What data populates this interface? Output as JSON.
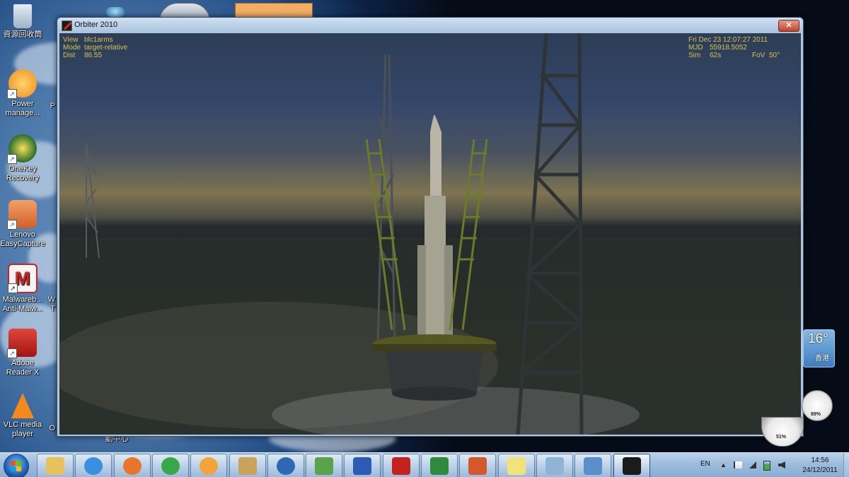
{
  "desktop": {
    "icons": [
      {
        "label": "資源回收筒",
        "icon": "recycle-bin-icon"
      },
      {
        "label": "Power manage...",
        "icon": "power-manager-icon"
      },
      {
        "label": "OneKey Recovery",
        "icon": "onekey-recovery-icon"
      },
      {
        "label": "Lenovo EasyCapture",
        "icon": "camera-icon"
      },
      {
        "label": "Malwareb... Anti-Malw...",
        "icon": "malwarebytes-icon"
      },
      {
        "label": "Adobe Reader X",
        "icon": "adobe-reader-icon"
      },
      {
        "label": "VLC media player",
        "icon": "vlc-icon"
      }
    ],
    "partial_labels": {
      "p": "P",
      "w": "W",
      "t": "T",
      "o": "O",
      "bottom": "動中心"
    }
  },
  "window": {
    "title": "Orbiter 2010",
    "close_label": "✕",
    "hud_left": [
      {
        "key": "View",
        "value": "blc1arms"
      },
      {
        "key": "Mode",
        "value": "target-relative"
      },
      {
        "key": "Dist",
        "value": "86.55"
      }
    ],
    "hud_right": {
      "datetime": "Fri Dec 23 12:07:27 2011",
      "mjd_key": "MJD",
      "mjd": "55918.5052",
      "sim_key": "Sim",
      "sim": "62s",
      "fov_key": "FoV",
      "fov": "50°"
    }
  },
  "gadgets": {
    "weather": {
      "temp": "16°",
      "city": "香港"
    },
    "gauge_cpu": "89%",
    "gauge_mem": "51%"
  },
  "taskbar": {
    "apps": [
      {
        "name": "explorer",
        "icon": "folder-icon",
        "color": "#e7c15b"
      },
      {
        "name": "ie",
        "icon": "internet-explorer-icon",
        "color": "#3b8fe0"
      },
      {
        "name": "firefox",
        "icon": "firefox-icon",
        "color": "#e7762a"
      },
      {
        "name": "chrome",
        "icon": "chrome-icon",
        "color": "#3aa64a"
      },
      {
        "name": "media",
        "icon": "media-player-icon",
        "color": "#f1a43a"
      },
      {
        "name": "photos",
        "icon": "photo-gallery-icon",
        "color": "#c9a35c"
      },
      {
        "name": "thunderbird",
        "icon": "thunderbird-icon",
        "color": "#2f67b3"
      },
      {
        "name": "messenger",
        "icon": "messenger-icon",
        "color": "#5aa34b"
      },
      {
        "name": "word",
        "icon": "word-icon",
        "color": "#2b5bb5"
      },
      {
        "name": "acrobat",
        "icon": "acrobat-icon",
        "color": "#c4231d"
      },
      {
        "name": "excel",
        "icon": "excel-icon",
        "color": "#2f8a3e"
      },
      {
        "name": "powerpoint",
        "icon": "powerpoint-icon",
        "color": "#d4572e"
      },
      {
        "name": "sticky",
        "icon": "sticky-notes-icon",
        "color": "#f2e27a"
      },
      {
        "name": "paint",
        "icon": "paint-icon",
        "color": "#8fb4d6"
      },
      {
        "name": "screen",
        "icon": "display-icon",
        "color": "#5b8fc9"
      },
      {
        "name": "orbiter",
        "icon": "orbiter-icon",
        "color": "#1b1b1b"
      }
    ],
    "tray": {
      "lang": "EN",
      "time": "14:56",
      "date": "24/12/2011"
    }
  }
}
